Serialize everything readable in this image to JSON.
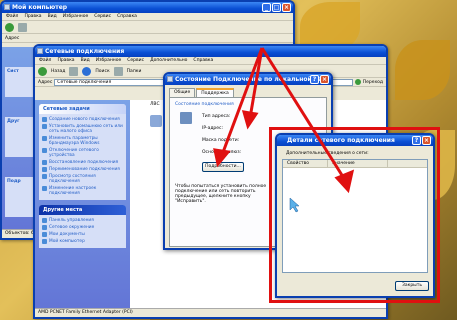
{
  "explorer": {
    "title": "Мой компьютер",
    "menu": [
      "Файл",
      "Правка",
      "Вид",
      "Избранное",
      "Сервис",
      "Справка"
    ],
    "address_label": "Адрес",
    "side_labels": [
      "Сист",
      "Друг",
      "Подр"
    ]
  },
  "netconn": {
    "title": "Сетевые подключения",
    "menu": [
      "Файл",
      "Правка",
      "Вид",
      "Избранное",
      "Сервис",
      "Дополнительно",
      "Справка"
    ],
    "toolbar": {
      "back": "Назад",
      "search": "Поиск",
      "folders": "Папки"
    },
    "address_label": "Адрес",
    "address_value": "Сетевые подключения",
    "go_label": "Переход",
    "net_tasks_header": "Сетевые задачи",
    "net_tasks": [
      "Создание нового подключения",
      "Установить домашнюю сеть или сеть малого офиса",
      "Изменить параметры брандмауэра Windows",
      "Отключение сетевого устройства",
      "Восстановление подключения",
      "Переименование подключения",
      "Просмотр состояния подключения",
      "Изменение настроек подключения"
    ],
    "other_header": "Другие места",
    "other_places": [
      "Панель управления",
      "Сетевое окружение",
      "Мои документы",
      "Мой компьютер"
    ],
    "column_header": "ЛВС",
    "status_bar": "AMD PCNET Family Ethernet Adapter (PCI)"
  },
  "status_dialog": {
    "title": "Состояние Подключение по локальной сети",
    "tabs": [
      "Общие",
      "Поддержка"
    ],
    "group_label": "Состояние подключения",
    "fields": [
      "Тип адреса:",
      "IP-адрес:",
      "Маска подсети:",
      "Основной шлюз:"
    ],
    "details_button": "Подробности...",
    "note": "Чтобы попытаться установить полное подключение или сеть повторить предыдущее, щелкните кнопку \"Исправить\"."
  },
  "details_dialog": {
    "title": "Детали сетевого подключения",
    "subtitle": "Дополнительные сведения о сети:",
    "columns": [
      "Свойство",
      "Значение"
    ],
    "close_button": "Закрыть"
  },
  "explorer_objects": "Объектов: 6",
  "accent_colors": {
    "xp_blue": "#0a4fd4",
    "highlight_red": "#e01010",
    "task_link": "#215dc6"
  }
}
